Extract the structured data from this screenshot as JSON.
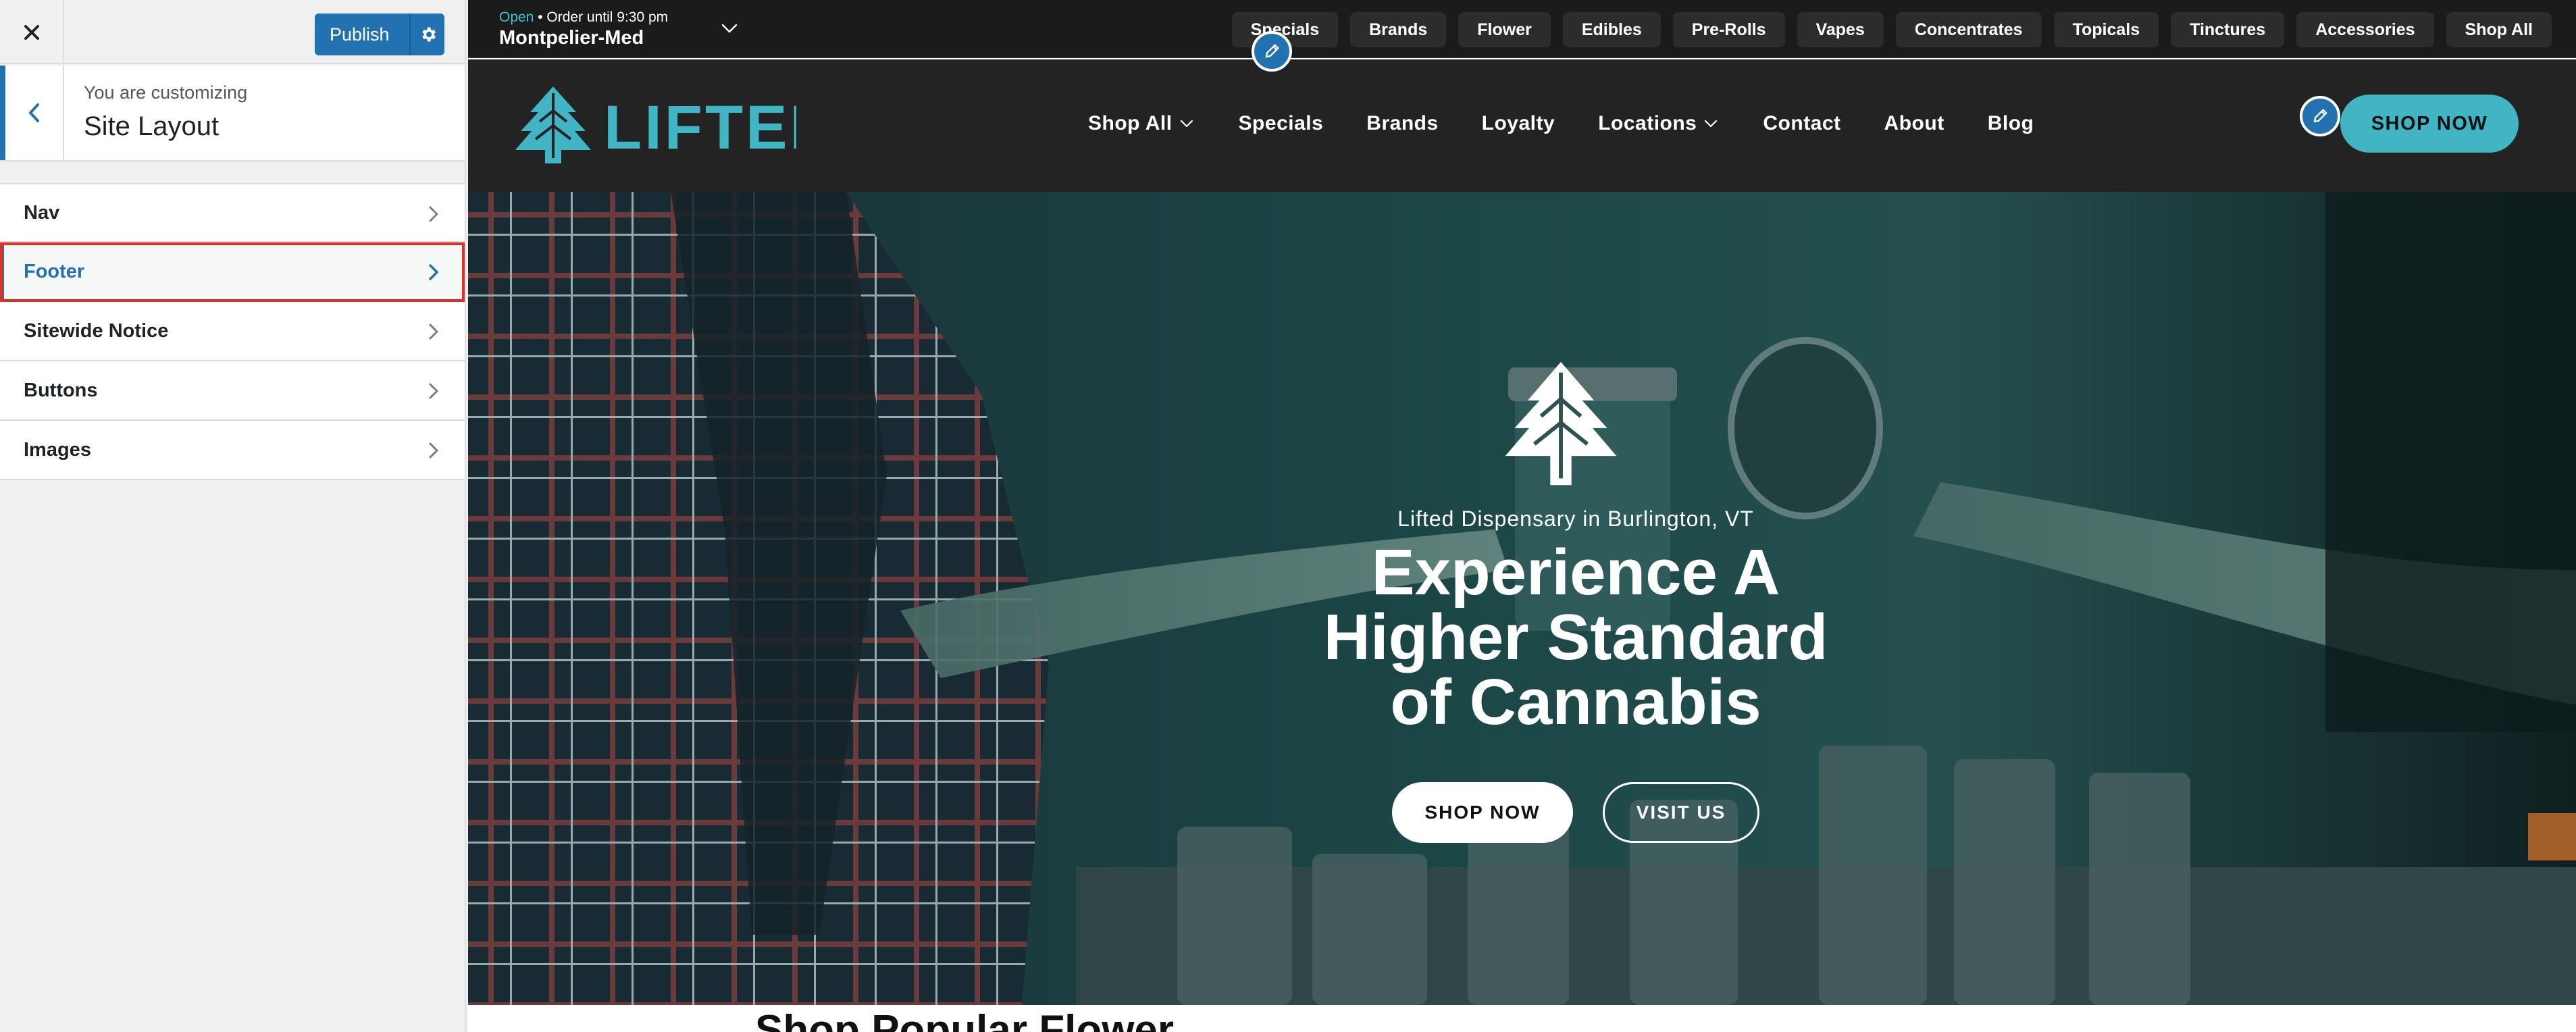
{
  "customizer": {
    "close_label": "×",
    "publish_label": "Publish",
    "panel": {
      "customizing_label": "You are customizing",
      "title": "Site Layout"
    },
    "sections": [
      {
        "label": "Nav",
        "selected": false
      },
      {
        "label": "Footer",
        "selected": true
      },
      {
        "label": "Sitewide Notice",
        "selected": false
      },
      {
        "label": "Buttons",
        "selected": false
      },
      {
        "label": "Images",
        "selected": false
      }
    ]
  },
  "site": {
    "topbar": {
      "status_open": "Open",
      "status_rest": " • Order until 9:30 pm",
      "store_name": "Montpelier-Med",
      "categories": [
        "Specials",
        "Brands",
        "Flower",
        "Edibles",
        "Pre-Rolls",
        "Vapes",
        "Concentrates",
        "Topicals",
        "Tinctures",
        "Accessories",
        "Shop All"
      ]
    },
    "nav": {
      "logo_text": "LIFTED",
      "items": [
        {
          "label": "Shop All",
          "dropdown": true
        },
        {
          "label": "Specials",
          "dropdown": false
        },
        {
          "label": "Brands",
          "dropdown": false
        },
        {
          "label": "Loyalty",
          "dropdown": false
        },
        {
          "label": "Locations",
          "dropdown": true
        },
        {
          "label": "Contact",
          "dropdown": false
        },
        {
          "label": "About",
          "dropdown": false
        },
        {
          "label": "Blog",
          "dropdown": false
        }
      ],
      "shop_now_label": "SHOP NOW"
    },
    "hero": {
      "subtitle": "Lifted Dispensary in Burlington, VT",
      "title_lines": [
        "Experience A",
        "Higher Standard",
        "of Cannabis"
      ],
      "shop_now_label": "SHOP NOW",
      "visit_label": "VISIT US"
    },
    "next_section_heading": "Shop Popular Flower"
  },
  "colors": {
    "wp_blue": "#2271b1",
    "brand_teal": "#41b5c4",
    "selection_outline": "#e02f23",
    "topbar_bg": "#1b1b1b",
    "nav_bg": "#232323"
  },
  "icons": {
    "close": "close-icon",
    "publish_settings": "gear-icon",
    "back": "chevron-left-icon",
    "section_arrow": "chevron-right-icon",
    "store_dropdown": "chevron-down-icon",
    "edit_shortcut": "pencil-icon",
    "brand": "tree-logo-icon"
  }
}
